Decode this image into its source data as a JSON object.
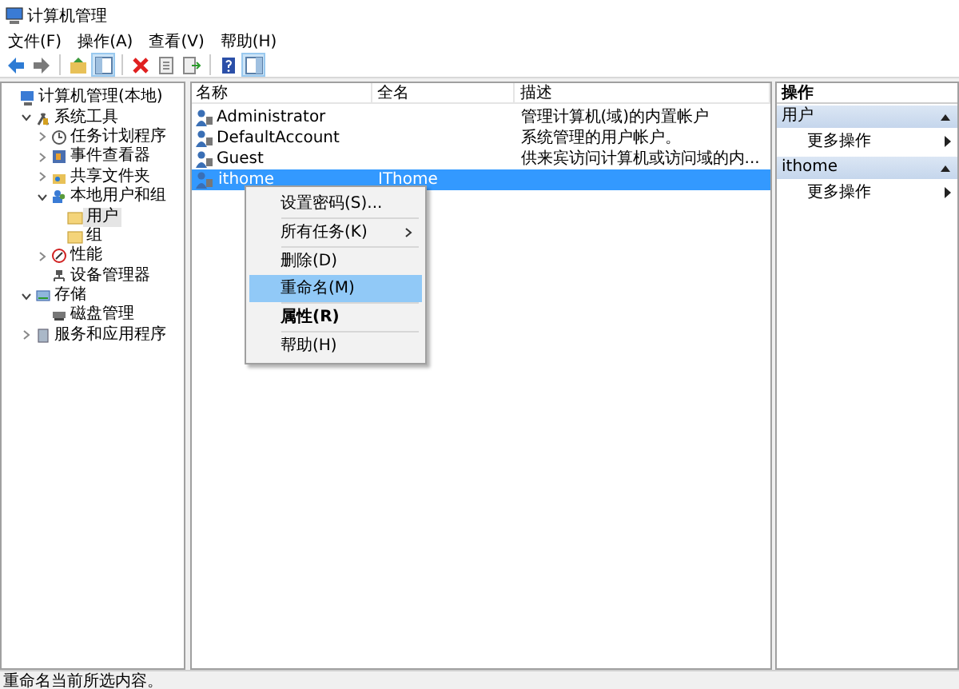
{
  "window": {
    "title": "计算机管理"
  },
  "menu_bar": [
    "文件(F)",
    "操作(A)",
    "查看(V)",
    "帮助(H)"
  ],
  "toolbar": [
    {
      "kind": "back",
      "pressed": false
    },
    {
      "kind": "forward",
      "pressed": false
    },
    {
      "kind": "sep"
    },
    {
      "kind": "up",
      "pressed": false
    },
    {
      "kind": "tree",
      "pressed": true
    },
    {
      "kind": "sep"
    },
    {
      "kind": "delete",
      "pressed": false
    },
    {
      "kind": "props",
      "pressed": false
    },
    {
      "kind": "export",
      "pressed": false
    },
    {
      "kind": "sep"
    },
    {
      "kind": "help",
      "pressed": false
    },
    {
      "kind": "view",
      "pressed": true
    }
  ],
  "tree": [
    {
      "label": "计算机管理(本地)",
      "selected": false,
      "kind": "computer",
      "children": [
        {
          "label": "系统工具",
          "selected": false,
          "expanded": true,
          "kind": "tools",
          "children": [
            {
              "label": "任务计划程序",
              "selected": false,
              "expanded": false,
              "kind": "clock"
            },
            {
              "label": "事件查看器",
              "selected": false,
              "expanded": false,
              "kind": "log"
            },
            {
              "label": "共享文件夹",
              "selected": false,
              "expanded": false,
              "kind": "share"
            },
            {
              "label": "本地用户和组",
              "selected": false,
              "expanded": true,
              "kind": "users",
              "children": [
                {
                  "label": "用户",
                  "selected": true,
                  "kind": "folder"
                },
                {
                  "label": "组",
                  "selected": false,
                  "kind": "folder"
                }
              ]
            },
            {
              "label": "性能",
              "selected": false,
              "expanded": false,
              "kind": "perf"
            },
            {
              "label": "设备管理器",
              "selected": false,
              "kind": "device"
            }
          ]
        },
        {
          "label": "存储",
          "selected": false,
          "expanded": true,
          "kind": "storage",
          "children": [
            {
              "label": "磁盘管理",
              "selected": false,
              "kind": "disk"
            }
          ]
        },
        {
          "label": "服务和应用程序",
          "selected": false,
          "expanded": false,
          "kind": "services"
        }
      ]
    }
  ],
  "table": {
    "columns": [
      "名称",
      "全名",
      "描述"
    ],
    "rows": [
      {
        "name": "Administrator",
        "full_name": "",
        "description": "管理计算机(域)的内置帐户",
        "selected": false
      },
      {
        "name": "DefaultAccount",
        "full_name": "",
        "description": "系统管理的用户帐户。",
        "selected": false
      },
      {
        "name": "Guest",
        "full_name": "",
        "description": "供来宾访问计算机或访问域的内...",
        "selected": false
      },
      {
        "name": "ithome",
        "full_name": "IThome",
        "description": "",
        "selected": true
      }
    ]
  },
  "context_menu": [
    [
      {
        "label": "设置密码(S)...",
        "selected": false,
        "bold": false,
        "submenu": false
      }
    ],
    [
      {
        "label": "所有任务(K)",
        "selected": false,
        "bold": false,
        "submenu": true
      }
    ],
    [
      {
        "label": "删除(D)",
        "selected": false,
        "bold": false,
        "submenu": false
      },
      {
        "label": "重命名(M)",
        "selected": true,
        "bold": false,
        "submenu": false
      }
    ],
    [
      {
        "label": "属性(R)",
        "selected": false,
        "bold": true,
        "submenu": false
      }
    ],
    [
      {
        "label": "帮助(H)",
        "selected": false,
        "bold": false,
        "submenu": false
      }
    ]
  ],
  "actions": {
    "title": "操作",
    "sections": [
      {
        "title": "用户",
        "items": [
          "更多操作"
        ]
      },
      {
        "title": "ithome",
        "items": [
          "更多操作"
        ]
      }
    ]
  },
  "status_bar": "重命名当前所选内容。"
}
